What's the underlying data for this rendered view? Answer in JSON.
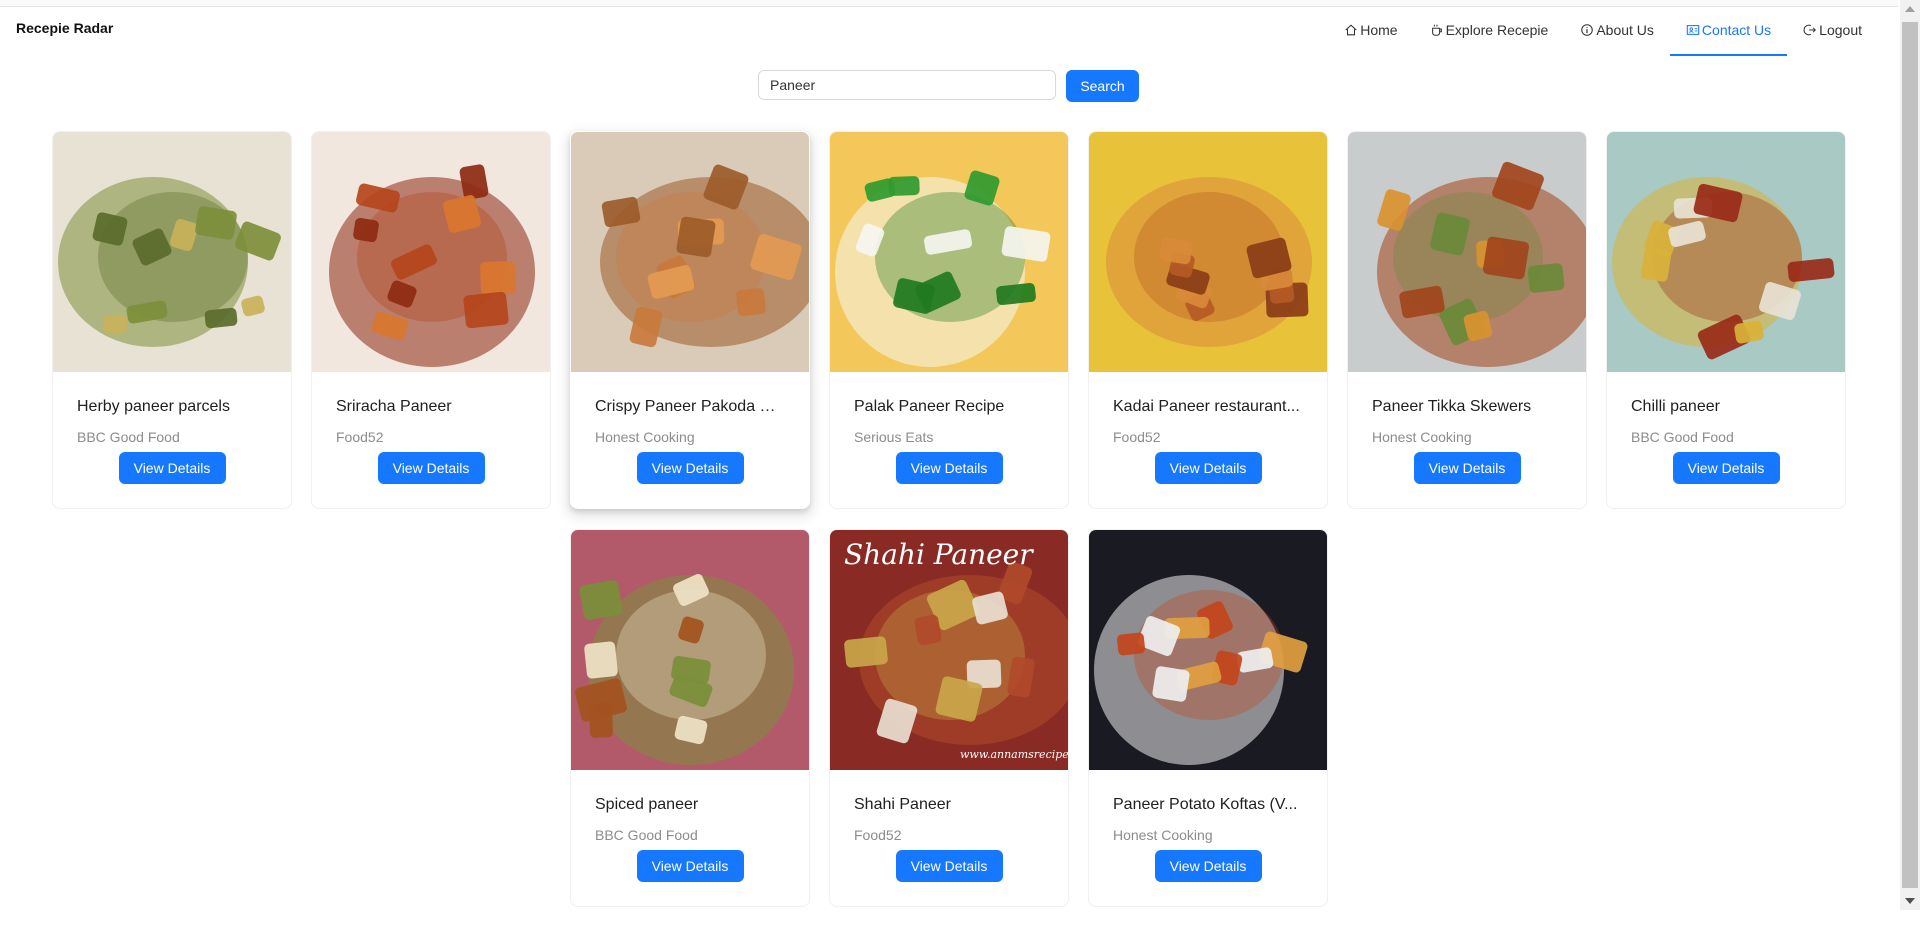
{
  "app": {
    "brand": "Recepie Radar"
  },
  "nav": {
    "items": [
      {
        "label": "Home",
        "icon": "home-icon"
      },
      {
        "label": "Explore Recepie",
        "icon": "cup-icon"
      },
      {
        "label": "About Us",
        "icon": "info-icon"
      },
      {
        "label": "Contact Us",
        "icon": "contact-card-icon",
        "active": true
      },
      {
        "label": "Logout",
        "icon": "logout-icon"
      }
    ]
  },
  "search": {
    "value": "Paneer",
    "button_label": "Search"
  },
  "colors": {
    "accent": "#1677ff"
  },
  "recipes": [
    {
      "title": "Herby paneer parcels",
      "source": "BBC Good Food",
      "button": "View Details",
      "palette": [
        "#e8e2d5",
        "#5a6b2b",
        "#c9b25a",
        "#7d8f3a"
      ]
    },
    {
      "title": "Sriracha Paneer",
      "source": "Food52",
      "button": "View Details",
      "palette": [
        "#f1e7df",
        "#b5451b",
        "#d9762f",
        "#8e2a12"
      ]
    },
    {
      "title": "Crispy Paneer Pakoda Fr...",
      "source": "Honest Cooking",
      "button": "View Details",
      "palette": [
        "#d9cbb8",
        "#c97a3c",
        "#e39a52",
        "#9c5b2a"
      ]
    },
    {
      "title": "Palak Paneer Recipe",
      "source": "Serious Eats",
      "button": "View Details",
      "palette": [
        "#f3c75a",
        "#1f7a1f",
        "#2f9a2f",
        "#f5f5f0"
      ]
    },
    {
      "title": "Kadai Paneer restaurant...",
      "source": "Food52",
      "button": "View Details",
      "palette": [
        "#e8c33a",
        "#b55a24",
        "#8a3c17",
        "#d98a3a"
      ]
    },
    {
      "title": "Paneer Tikka Skewers",
      "source": "Honest Cooking",
      "button": "View Details",
      "palette": [
        "#c9cccc",
        "#6b8a3a",
        "#d9932f",
        "#a2451c"
      ]
    },
    {
      "title": "Chilli paneer",
      "source": "BBC Good Food",
      "button": "View Details",
      "palette": [
        "#a9c9c4",
        "#9a2a18",
        "#e8e2d5",
        "#d9b23a"
      ]
    },
    {
      "title": "Spiced paneer",
      "source": "BBC Good Food",
      "button": "View Details",
      "palette": [
        "#b35a6a",
        "#efe3c5",
        "#a3521f",
        "#7a8f3a"
      ]
    },
    {
      "title": "Shahi Paneer",
      "source": "Food52",
      "button": "View Details",
      "palette": [
        "#8a2a24",
        "#c9a64a",
        "#e8e0d0",
        "#b04a2a"
      ],
      "overlay_text": "Shahi Paneer",
      "watermark": "www.annamsrecipes"
    },
    {
      "title": "Paneer Potato Koftas (V...",
      "source": "Honest Cooking",
      "button": "View Details",
      "palette": [
        "#1a1a22",
        "#c2451c",
        "#e0a040",
        "#efefef"
      ]
    }
  ]
}
